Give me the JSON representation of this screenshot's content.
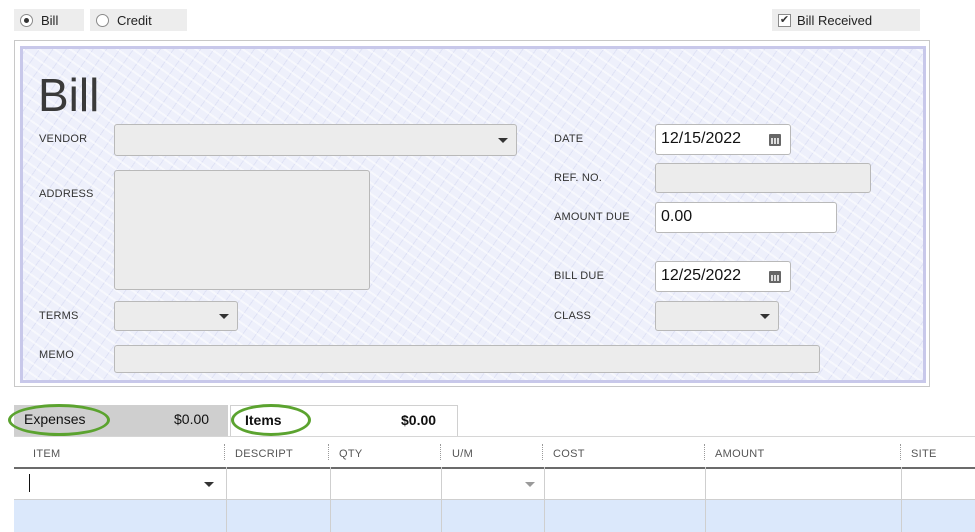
{
  "topbar": {
    "bill_radio_label": "Bill",
    "credit_radio_label": "Credit",
    "bill_received_label": "Bill Received"
  },
  "form": {
    "title": "Bill",
    "vendor_label": "VENDOR",
    "address_label": "ADDRESS",
    "terms_label": "TERMS",
    "memo_label": "MEMO",
    "date_label": "DATE",
    "date_value": "12/15/2022",
    "ref_no_label": "REF. NO.",
    "amount_due_label": "AMOUNT DUE",
    "amount_due_value": "0.00",
    "bill_due_label": "BILL DUE",
    "bill_due_value": "12/25/2022",
    "class_label": "CLASS"
  },
  "tabs": [
    {
      "label": "Expenses",
      "amount": "$0.00"
    },
    {
      "label": "Items",
      "amount": "$0.00"
    }
  ],
  "grid": {
    "columns": [
      "ITEM",
      "DESCRIPT",
      "QTY",
      "U/M",
      "COST",
      "AMOUNT",
      "SITE"
    ]
  },
  "colors": {
    "highlight_oval": "#5ba32f",
    "paper_border": "#c8c8ea",
    "selected_row": "#dbe8fb"
  }
}
